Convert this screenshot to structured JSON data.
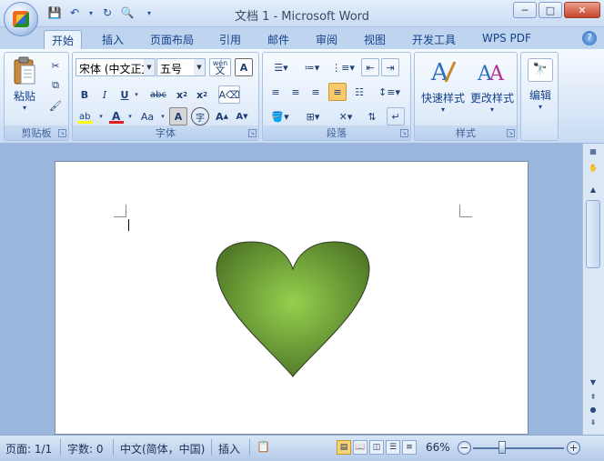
{
  "window": {
    "title": "文档 1 - Microsoft Word",
    "minimize": "─",
    "maximize": "□",
    "close": "✕"
  },
  "tabs": [
    {
      "label": "开始",
      "active": true
    },
    {
      "label": "插入"
    },
    {
      "label": "页面布局"
    },
    {
      "label": "引用"
    },
    {
      "label": "邮件"
    },
    {
      "label": "审阅"
    },
    {
      "label": "视图"
    },
    {
      "label": "开发工具"
    },
    {
      "label": "WPS PDF"
    }
  ],
  "ribbon": {
    "clipboard": {
      "label": "剪贴板",
      "paste_label": "粘贴"
    },
    "font": {
      "label": "字体",
      "font_name": "宋体 (中文正文)",
      "font_size": "五号",
      "wen_label": "wén"
    },
    "paragraph": {
      "label": "段落"
    },
    "styles": {
      "label": "样式",
      "quick_styles": "快速样式",
      "change_styles": "更改样式"
    },
    "editing": {
      "label": "编辑"
    }
  },
  "statusbar": {
    "page": "页面: 1/1",
    "words": "字数: 0",
    "language": "中文(简体，中国)",
    "mode": "插入",
    "zoom": "66%"
  },
  "shape": {
    "type": "heart",
    "fill_center": "#96d04e",
    "fill_edge": "#4d7526"
  }
}
